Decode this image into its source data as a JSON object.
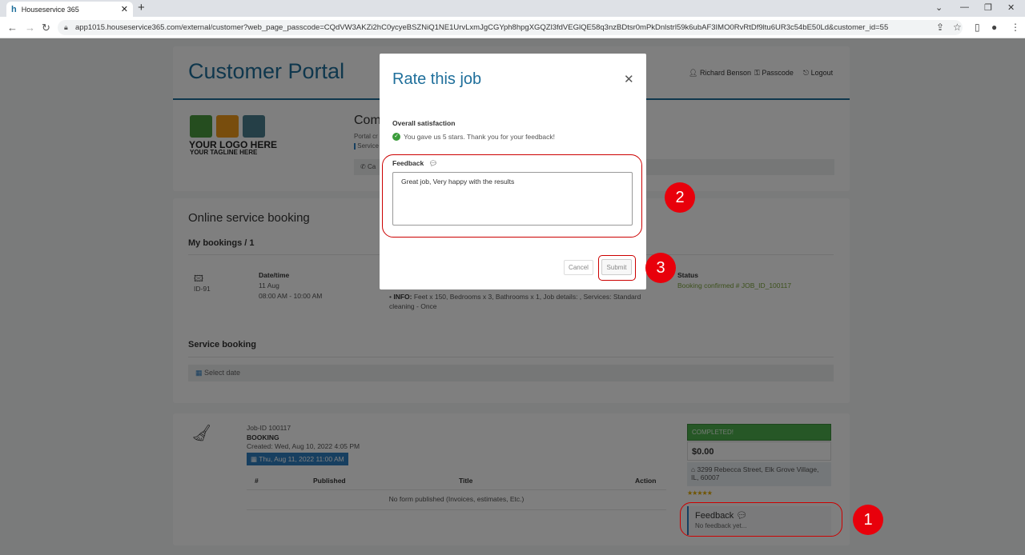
{
  "browser": {
    "tab_title": "Houseservice 365",
    "url": "app1015.houseservice365.com/external/customer?web_page_passcode=CQdVW3AKZi2hC0ycyeBSZNiQ1NE1UrvLxmJgCGYph8hpgXGQZl3fdVEGlQE58q3nzBDtsr0mPkDnlstrl59k6ubAF3IMO0RvRtDf9ltu6UR3c54bE50Ld&customer_id=55"
  },
  "header": {
    "title": "Customer Portal",
    "user_name": "Richard Benson",
    "passcode_label": "Passcode",
    "logout_label": "Logout"
  },
  "logo": {
    "line1": "YOUR LOGO HERE",
    "line2": "YOUR TAGLINE HERE"
  },
  "company": {
    "title_partial": "Com",
    "sub1": "Portal cr",
    "sub2": "Service",
    "call_partial": "Ca"
  },
  "booking": {
    "section_title": "Online service booking",
    "my_bookings": "My bookings / 1",
    "id": "ID-91",
    "datetime_label": "Date/time",
    "date": "11 Aug",
    "time": "08:00 AM - 10:00 AM",
    "info_label": "INFO:",
    "info_text": "Feet x 150, Bedrooms x 3, Bathrooms x 1, Job details: , Services: Standard cleaning - Once",
    "status_label": "Status",
    "status_value": "Booking confirmed # JOB_ID_100117",
    "service_booking_title": "Service booking",
    "select_date": "Select date"
  },
  "job": {
    "job_id": "Job-ID 100117",
    "type": "BOOKING",
    "created": "Created: Wed, Aug 10, 2022 4:05 PM",
    "date_badge": "Thu, Aug 11, 2022 11:00 AM",
    "table_headers": [
      "#",
      "Published",
      "Title",
      "Action"
    ],
    "table_empty": "No form published (Invoices, estimates, Etc.)",
    "status": "COMPLETED!",
    "amount": "$0.00",
    "address": "3299 Rebecca Street, Elk Grove Village, IL, 60007",
    "rating_stars": 5,
    "feedback_title": "Feedback",
    "feedback_text": "No feedback yet..."
  },
  "modal": {
    "title": "Rate this job",
    "satisfaction_label": "Overall satisfaction",
    "satisfaction_text": "You gave us 5 stars. Thank you for your feedback!",
    "feedback_label": "Feedback",
    "feedback_value": "Great job, Very happy with the results",
    "cancel_label": "Cancel",
    "submit_label": "Submit"
  },
  "annotations": {
    "step1": "1",
    "step2": "2",
    "step3": "3",
    "color": "#e8000b"
  },
  "colors": {
    "brand_blue": "#1f6f9b",
    "completed_green": "#4cae4c",
    "badge_blue": "#2f7fc1"
  }
}
